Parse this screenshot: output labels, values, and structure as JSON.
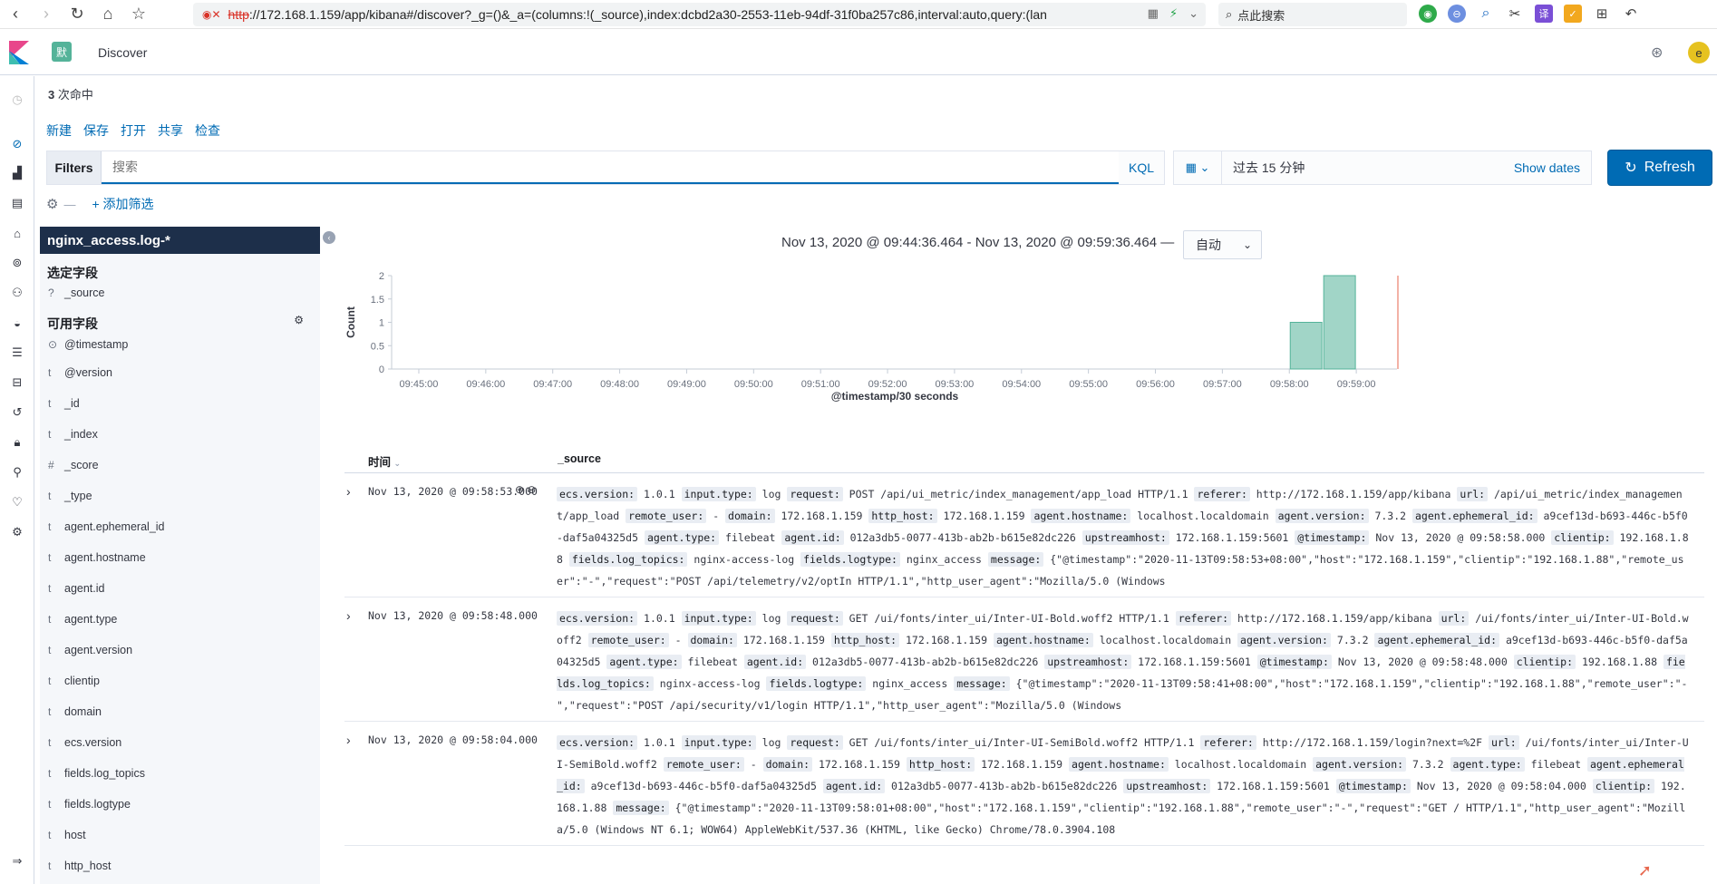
{
  "browser": {
    "url_http": "http",
    "url_rest": "://172.168.1.159/app/kibana#/discover?_g=()&_a=(columns:!(_source),index:dcbd2a30-2553-11eb-94df-31f0ba257c86,interval:auto,query:(lan",
    "search_placeholder": "点此搜索"
  },
  "header": {
    "space_badge": "默",
    "app_title": "Discover",
    "avatar_initial": "e"
  },
  "hits": {
    "count": "3",
    "label": " 次命中"
  },
  "top_menu": [
    "新建",
    "保存",
    "打开",
    "共享",
    "检查"
  ],
  "query_bar": {
    "filters_label": "Filters",
    "placeholder": "搜索",
    "kql": "KQL",
    "date_text": "过去 15 分钟",
    "show_dates": "Show dates",
    "refresh": "Refresh",
    "add_filter": "+ 添加筛选"
  },
  "sidebar": {
    "index_pattern": "nginx_access.log-*",
    "selected_title": "选定字段",
    "selected_fields": [
      {
        "type": "?",
        "name": "_source"
      }
    ],
    "available_title": "可用字段",
    "available_fields": [
      {
        "type": "⊙",
        "name": "@timestamp"
      },
      {
        "type": "t",
        "name": "@version"
      },
      {
        "type": "t",
        "name": "_id"
      },
      {
        "type": "t",
        "name": "_index"
      },
      {
        "type": "#",
        "name": "_score"
      },
      {
        "type": "t",
        "name": "_type"
      },
      {
        "type": "t",
        "name": "agent.ephemeral_id"
      },
      {
        "type": "t",
        "name": "agent.hostname"
      },
      {
        "type": "t",
        "name": "agent.id"
      },
      {
        "type": "t",
        "name": "agent.type"
      },
      {
        "type": "t",
        "name": "agent.version"
      },
      {
        "type": "t",
        "name": "clientip"
      },
      {
        "type": "t",
        "name": "domain"
      },
      {
        "type": "t",
        "name": "ecs.version"
      },
      {
        "type": "t",
        "name": "fields.log_topics"
      },
      {
        "type": "t",
        "name": "fields.logtype"
      },
      {
        "type": "t",
        "name": "host"
      },
      {
        "type": "t",
        "name": "http_host"
      }
    ]
  },
  "main": {
    "time_range": "Nov 13, 2020 @ 09:44:36.464 - Nov 13, 2020 @ 09:59:36.464 —",
    "interval": "自动"
  },
  "chart_data": {
    "type": "bar",
    "title": "",
    "xlabel": "@timestamp/30 seconds",
    "ylabel": "Count",
    "ylim": [
      0,
      2
    ],
    "yticks": [
      "0",
      "0.5",
      "1",
      "1.5",
      "2"
    ],
    "xticks": [
      "09:45:00",
      "09:46:00",
      "09:47:00",
      "09:48:00",
      "09:49:00",
      "09:50:00",
      "09:51:00",
      "09:52:00",
      "09:53:00",
      "09:54:00",
      "09:55:00",
      "09:56:00",
      "09:57:00",
      "09:58:00",
      "09:59:00"
    ],
    "bars": [
      {
        "x": "09:58:00",
        "value": 1
      },
      {
        "x": "09:58:30",
        "value": 2
      }
    ],
    "color": "#54b399"
  },
  "table": {
    "col_time": "时间",
    "col_source": "_source",
    "rows": [
      {
        "time": "Nov 13, 2020 @ 09:58:53.000",
        "fields": [
          [
            "ecs.version:",
            "1.0.1"
          ],
          [
            "input.type:",
            "log"
          ],
          [
            "request:",
            "POST /api/ui_metric/index_management/app_load HTTP/1.1"
          ],
          [
            "referer:",
            "http://172.168.1.159/app/kibana"
          ],
          [
            "url:",
            "/api/ui_metric/index_management/app_load"
          ],
          [
            "remote_user:",
            "-"
          ],
          [
            "domain:",
            "172.168.1.159"
          ],
          [
            "http_host:",
            "172.168.1.159"
          ],
          [
            "agent.hostname:",
            "localhost.localdomain"
          ],
          [
            "agent.version:",
            "7.3.2"
          ],
          [
            "agent.ephemeral_id:",
            "a9cef13d-b693-446c-b5f0-daf5a04325d5"
          ],
          [
            "agent.type:",
            "filebeat"
          ],
          [
            "agent.id:",
            "012a3db5-0077-413b-ab2b-b615e82dc226"
          ],
          [
            "upstreamhost:",
            "172.168.1.159:5601"
          ],
          [
            "@timestamp:",
            "Nov 13, 2020 @ 09:58:58.000"
          ],
          [
            "clientip:",
            "192.168.1.88"
          ],
          [
            "fields.log_topics:",
            "nginx-access-log"
          ],
          [
            "fields.logtype:",
            "nginx_access"
          ],
          [
            "message:",
            "{\"@timestamp\":\"2020-11-13T09:58:53+08:00\",\"host\":\"172.168.1.159\",\"clientip\":\"192.168.1.88\",\"remote_user\":\"-\",\"request\":\"POST /api/telemetry/v2/optIn HTTP/1.1\",\"http_user_agent\":\"Mozilla/5.0 (Windows"
          ]
        ]
      },
      {
        "time": "Nov 13, 2020 @ 09:58:48.000",
        "fields": [
          [
            "ecs.version:",
            "1.0.1"
          ],
          [
            "input.type:",
            "log"
          ],
          [
            "request:",
            "GET /ui/fonts/inter_ui/Inter-UI-Bold.woff2 HTTP/1.1"
          ],
          [
            "referer:",
            "http://172.168.1.159/app/kibana"
          ],
          [
            "url:",
            "/ui/fonts/inter_ui/Inter-UI-Bold.woff2"
          ],
          [
            "remote_user:",
            "-"
          ],
          [
            "domain:",
            "172.168.1.159"
          ],
          [
            "http_host:",
            "172.168.1.159"
          ],
          [
            "agent.hostname:",
            "localhost.localdomain"
          ],
          [
            "agent.version:",
            "7.3.2"
          ],
          [
            "agent.ephemeral_id:",
            "a9cef13d-b693-446c-b5f0-daf5a04325d5"
          ],
          [
            "agent.type:",
            "filebeat"
          ],
          [
            "agent.id:",
            "012a3db5-0077-413b-ab2b-b615e82dc226"
          ],
          [
            "upstreamhost:",
            "172.168.1.159:5601"
          ],
          [
            "@timestamp:",
            "Nov 13, 2020 @ 09:58:48.000"
          ],
          [
            "clientip:",
            "192.168.1.88"
          ],
          [
            "fields.log_topics:",
            "nginx-access-log"
          ],
          [
            "fields.logtype:",
            "nginx_access"
          ],
          [
            "message:",
            "{\"@timestamp\":\"2020-11-13T09:58:41+08:00\",\"host\":\"172.168.1.159\",\"clientip\":\"192.168.1.88\",\"remote_user\":\"-\",\"request\":\"POST /api/security/v1/login HTTP/1.1\",\"http_user_agent\":\"Mozilla/5.0 (Windows"
          ]
        ]
      },
      {
        "time": "Nov 13, 2020 @ 09:58:04.000",
        "fields": [
          [
            "ecs.version:",
            "1.0.1"
          ],
          [
            "input.type:",
            "log"
          ],
          [
            "request:",
            "GET /ui/fonts/inter_ui/Inter-UI-SemiBold.woff2 HTTP/1.1"
          ],
          [
            "referer:",
            "http://172.168.1.159/login?next=%2F"
          ],
          [
            "url:",
            "/ui/fonts/inter_ui/Inter-UI-SemiBold.woff2"
          ],
          [
            "remote_user:",
            "-"
          ],
          [
            "domain:",
            "172.168.1.159"
          ],
          [
            "http_host:",
            "172.168.1.159"
          ],
          [
            "agent.hostname:",
            "localhost.localdomain"
          ],
          [
            "agent.version:",
            "7.3.2"
          ],
          [
            "agent.type:",
            "filebeat"
          ],
          [
            "agent.ephemeral_id:",
            "a9cef13d-b693-446c-b5f0-daf5a04325d5"
          ],
          [
            "agent.id:",
            "012a3db5-0077-413b-ab2b-b615e82dc226"
          ],
          [
            "upstreamhost:",
            "172.168.1.159:5601"
          ],
          [
            "@timestamp:",
            "Nov 13, 2020 @ 09:58:04.000"
          ],
          [
            "clientip:",
            "192.168.1.88"
          ],
          [
            "message:",
            "{\"@timestamp\":\"2020-11-13T09:58:01+08:00\",\"host\":\"172.168.1.159\",\"clientip\":\"192.168.1.88\",\"remote_user\":\"-\",\"request\":\"GET / HTTP/1.1\",\"http_user_agent\":\"Mozilla/5.0 (Windows NT 6.1; WOW64) AppleWebKit/537.36 (KHTML, like Gecko) Chrome/78.0.3904.108"
          ]
        ]
      }
    ]
  }
}
